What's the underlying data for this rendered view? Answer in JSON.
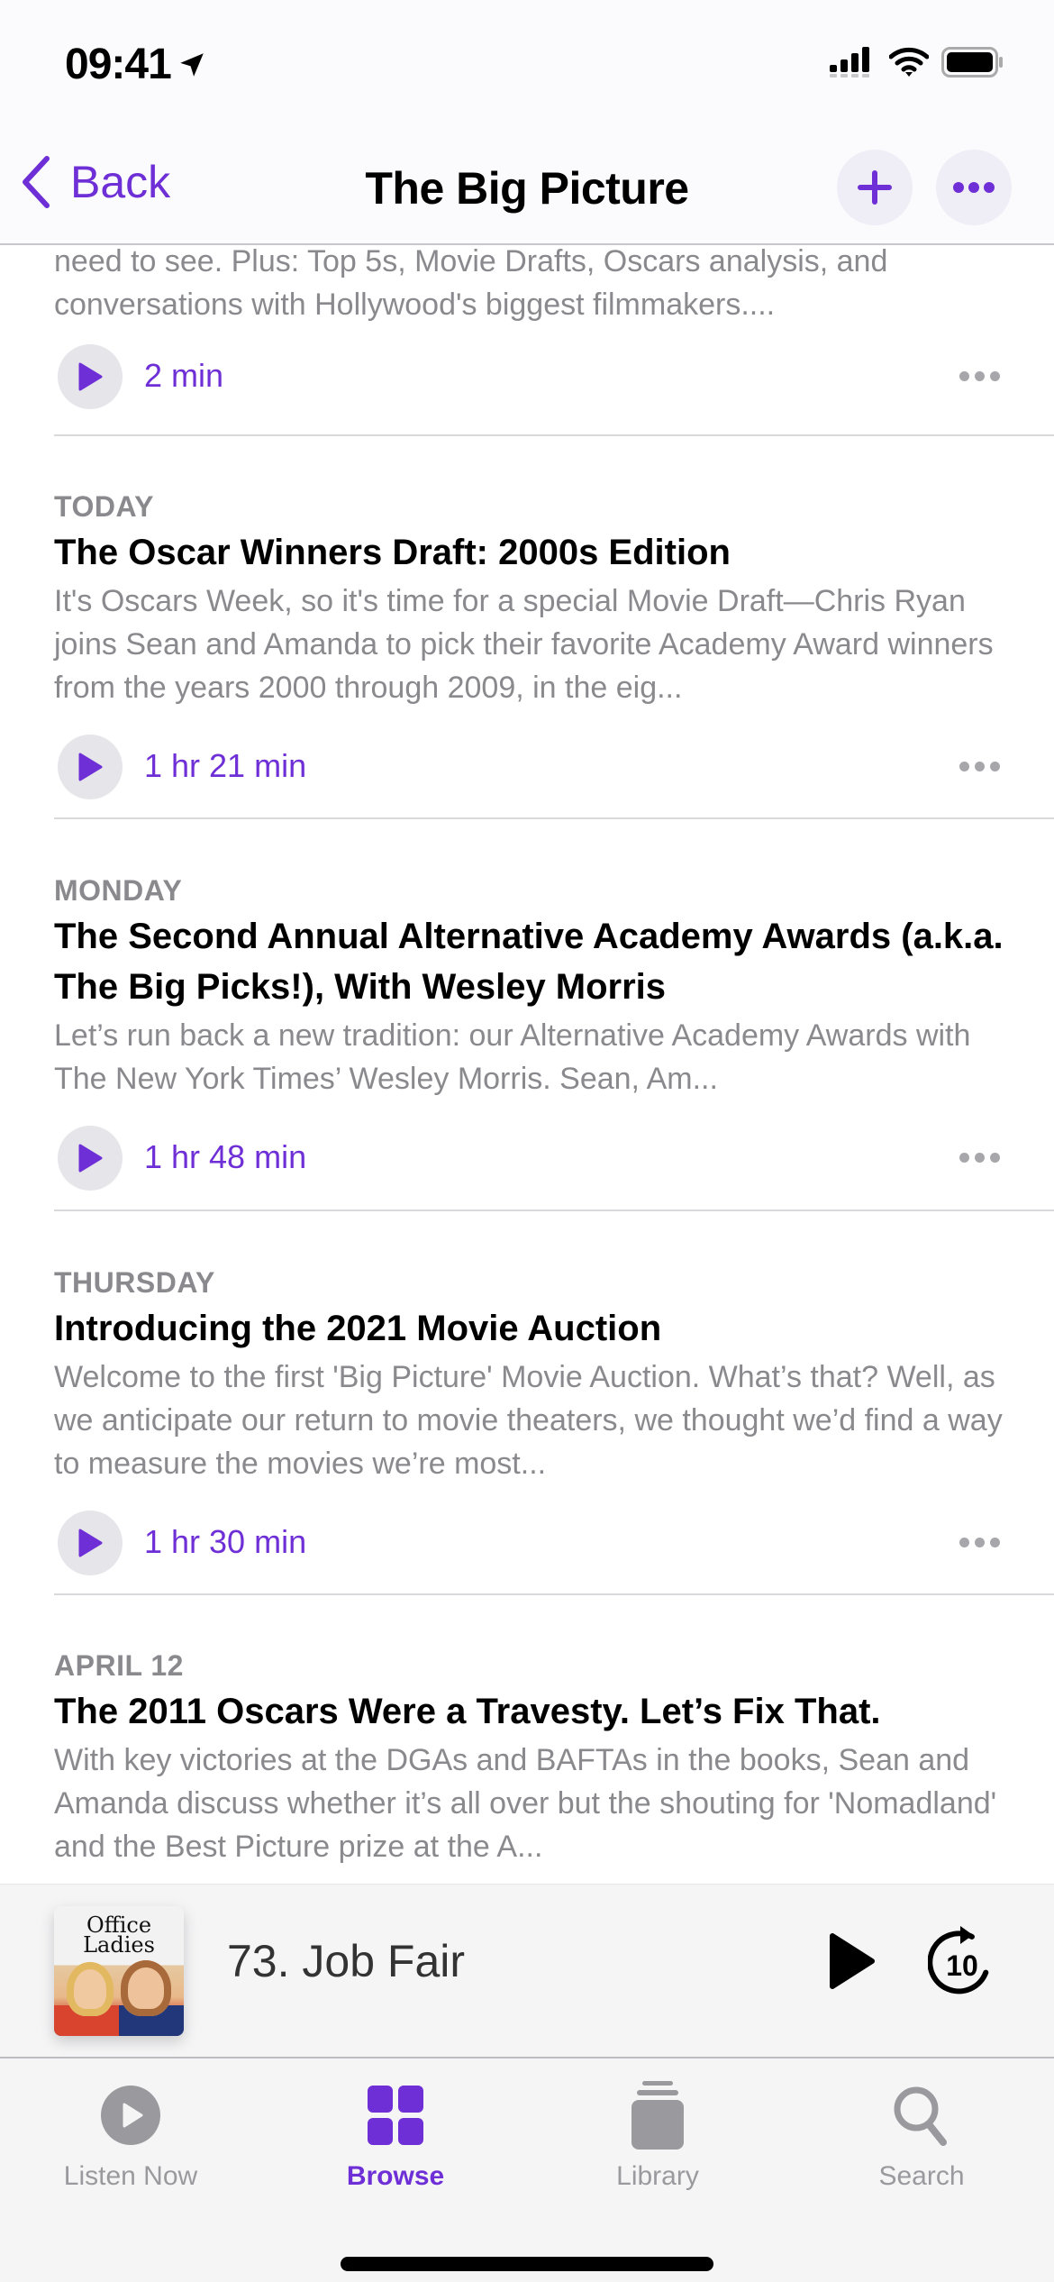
{
  "status_bar": {
    "time": "09:41",
    "icons": [
      "location-arrow-icon",
      "cellular-signal-icon",
      "wifi-icon",
      "battery-icon"
    ]
  },
  "nav": {
    "back_label": "Back",
    "title": "The Big Picture",
    "add_icon": "plus-icon",
    "more_icon": "ellipsis-icon"
  },
  "colors": {
    "accent": "#6e2fd6",
    "secondary_text": "#8a8a8e",
    "play_circle_bg": "#e5e5ea"
  },
  "partial_episode": {
    "description": "need to see. Plus: Top 5s, Movie Drafts, Oscars analysis, and conversations with Hollywood's biggest filmmakers....",
    "duration": "2 min"
  },
  "episodes": [
    {
      "date": "TODAY",
      "title": "The Oscar Winners Draft: 2000s Edition",
      "description": "It's Oscars Week, so it's time for a special Movie Draft—Chris Ryan joins Sean and Amanda to pick their favorite Academy Award winners from the years 2000 through 2009, in the eig...",
      "duration": "1 hr 21 min"
    },
    {
      "date": "MONDAY",
      "title": "The Second Annual Alternative Academy Awards (a.k.a. The Big Picks!), With Wesley Morris",
      "description": "Let’s run back a new tradition: our Alternative Academy Awards with The New York Times’ Wesley Morris. Sean, Am...",
      "duration": "1 hr 48 min"
    },
    {
      "date": "THURSDAY",
      "title": "Introducing the 2021 Movie Auction",
      "description": "Welcome to the first 'Big Picture' Movie Auction. What’s that? Well, as we anticipate our return to movie theaters, we thought we’d find a way to measure the movies we’re most...",
      "duration": "1 hr 30 min"
    },
    {
      "date": "APRIL 12",
      "title": "The 2011 Oscars Were a Travesty. Let’s Fix That.",
      "description": "With key victories at the DGAs and BAFTAs in the books, Sean and Amanda discuss whether it’s all over but the shouting for 'Nomadland' and the Best Picture prize at the A..."
    }
  ],
  "mini_player": {
    "artwork_title_line1": "Office",
    "artwork_title_line2": "Ladies",
    "episode_title": "73. Job Fair",
    "skip_seconds": "10"
  },
  "tabs": [
    {
      "label": "Listen Now",
      "icon": "play-circle-icon",
      "active": false
    },
    {
      "label": "Browse",
      "icon": "grid-icon",
      "active": true
    },
    {
      "label": "Library",
      "icon": "library-stack-icon",
      "active": false
    },
    {
      "label": "Search",
      "icon": "magnifier-icon",
      "active": false
    }
  ]
}
